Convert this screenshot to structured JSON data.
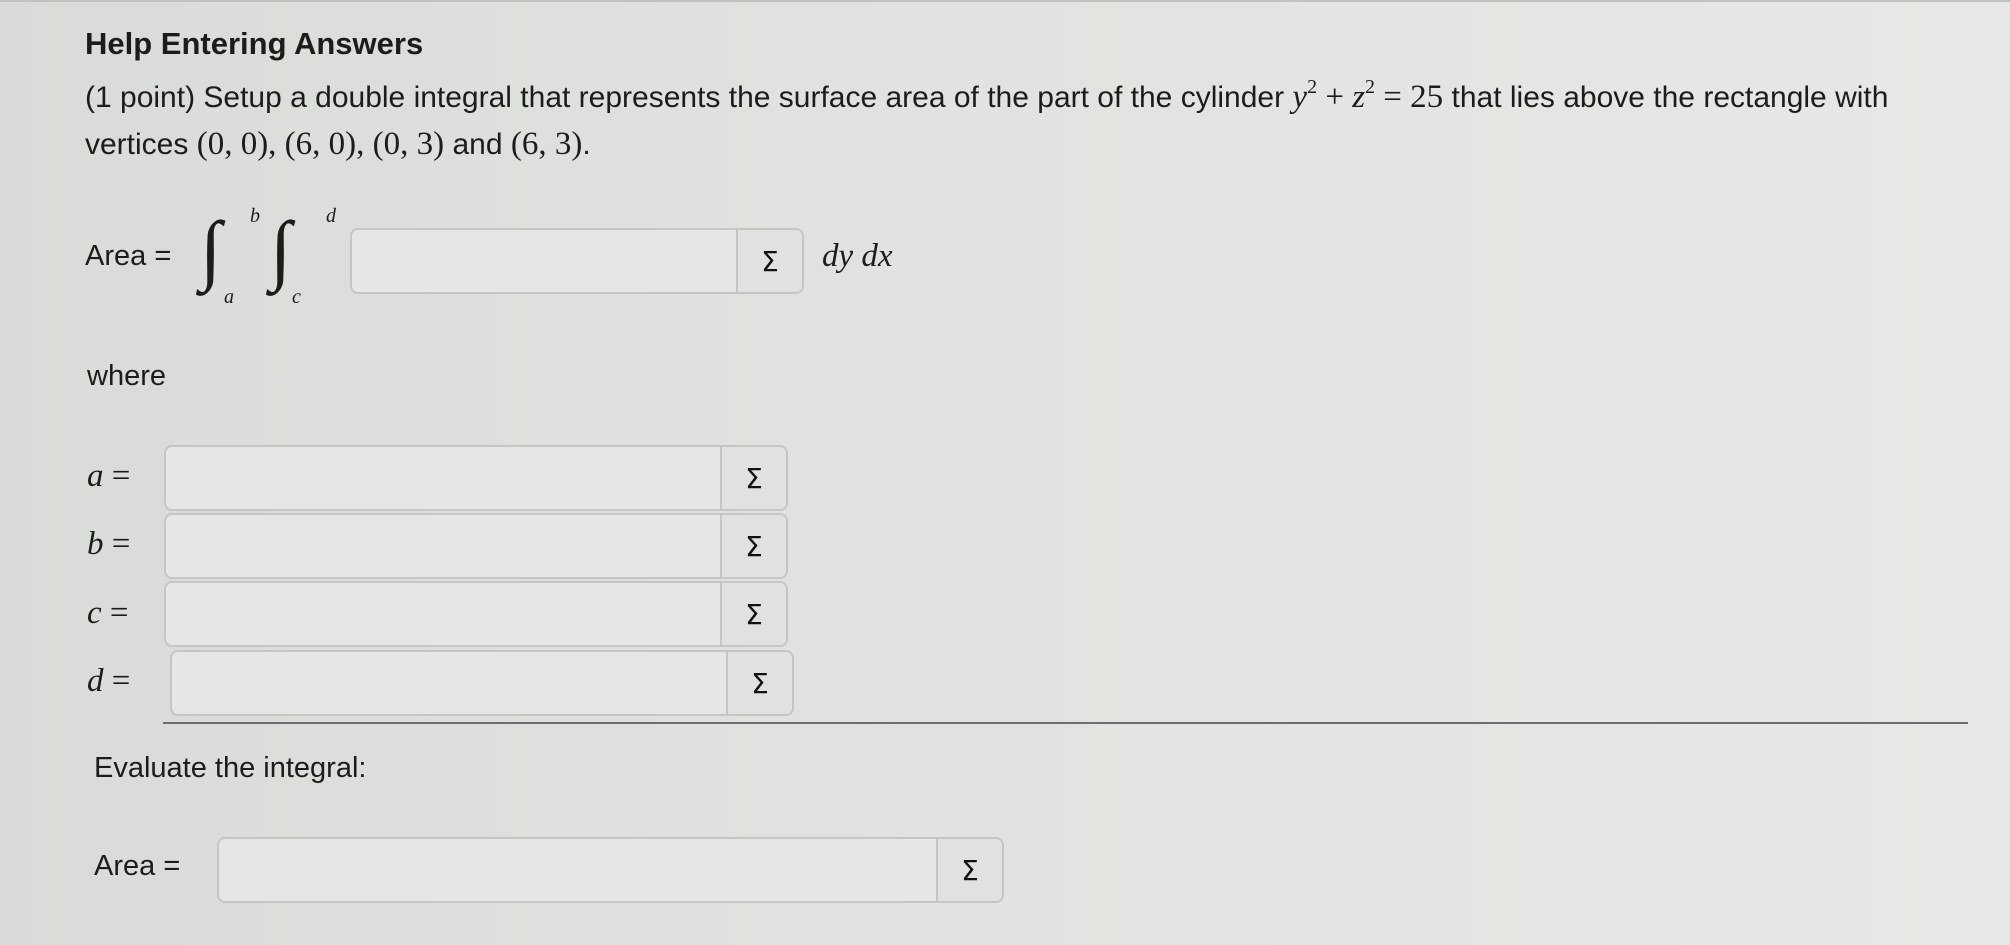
{
  "header": {
    "help_link": "Help Entering Answers"
  },
  "question": {
    "intro": "(1 point) Setup a double integral that represents the surface area of the part of the cylinder ",
    "eq_y": "y",
    "eq_plus": " + ",
    "eq_z": "z",
    "eq_exp": "2",
    "eq_rhs": " = 25",
    "after_eq": " that lies above the rectangle with vertices ",
    "vertices": "(0, 0), (6, 0), (0, 3)",
    "and": " and ",
    "last_vertex": "(6, 3)",
    "end": "."
  },
  "integral": {
    "label": "Area =",
    "upper_outer": "b",
    "lower_outer": "a",
    "upper_inner": "d",
    "lower_inner": "c",
    "differentials": "dy dx",
    "sigma": "Σ"
  },
  "where_label": "where",
  "bounds": [
    {
      "var": "a",
      "eq": " =",
      "sigma": "Σ"
    },
    {
      "var": "b",
      "eq": " =",
      "sigma": "Σ"
    },
    {
      "var": "c",
      "eq": " =",
      "sigma": "Σ"
    },
    {
      "var": "d",
      "eq": " =",
      "sigma": "Σ"
    }
  ],
  "evaluate": {
    "label": "Evaluate the integral:",
    "area_label": "Area =",
    "sigma": "Σ"
  }
}
